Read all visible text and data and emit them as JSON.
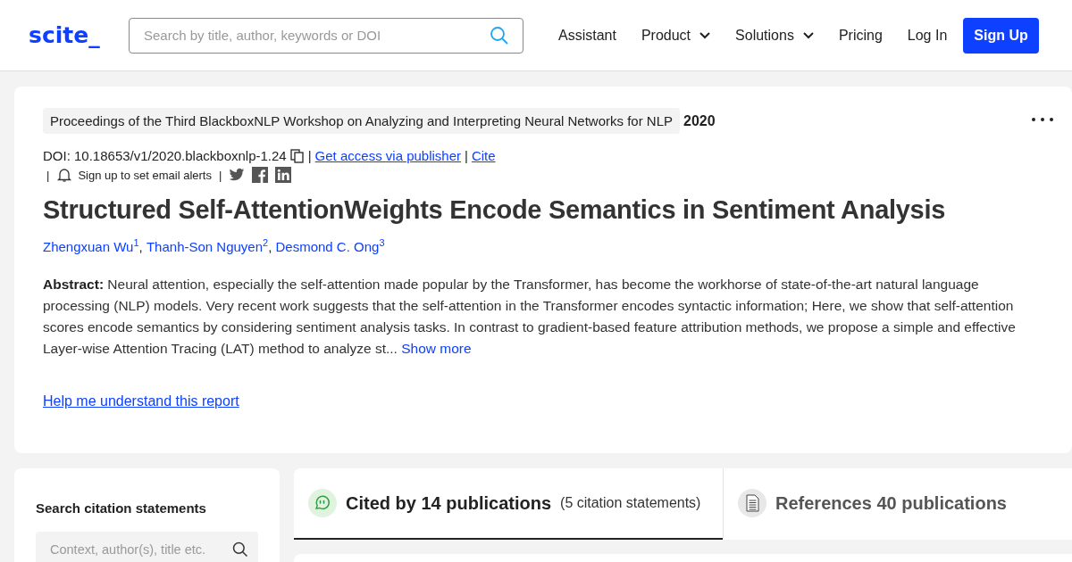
{
  "header": {
    "logo": "scite_",
    "search": {
      "placeholder": "Search by title, author, keywords or DOI"
    },
    "nav": [
      {
        "label": "Assistant",
        "kind": "link"
      },
      {
        "label": "Product",
        "kind": "dropdown"
      },
      {
        "label": "Solutions",
        "kind": "dropdown"
      },
      {
        "label": "Pricing",
        "kind": "link"
      },
      {
        "label": "Log In",
        "kind": "link"
      }
    ],
    "signup": "Sign Up"
  },
  "paper": {
    "venue": "Proceedings of the Third BlackboxNLP Workshop on Analyzing and Interpreting Neural Networks for NLP",
    "year": "2020",
    "meta_rows": [
      [
        {
          "kind": "text",
          "text": "DOI: 10.18653/v1/2020.blackboxnlp-1.24"
        },
        {
          "kind": "copy"
        },
        {
          "kind": "sep",
          "text": "|"
        },
        {
          "kind": "link",
          "text": "Get access via publisher"
        },
        {
          "kind": "sep",
          "text": "|"
        },
        {
          "kind": "link",
          "text": "Cite"
        }
      ],
      [
        {
          "kind": "sep",
          "text": "|"
        },
        {
          "kind": "alert",
          "text": "Sign up to set email alerts"
        },
        {
          "kind": "sep",
          "text": "|"
        },
        {
          "kind": "twitter"
        },
        {
          "kind": "facebook"
        },
        {
          "kind": "linkedin"
        }
      ]
    ],
    "title": "Structured Self-AttentionWeights Encode Semantics in Sentiment Analysis",
    "authors": [
      {
        "name": "Zhengxuan Wu",
        "sup": "1"
      },
      {
        "name": "Thanh-Son Nguyen",
        "sup": "2"
      },
      {
        "name": "Desmond C. Ong",
        "sup": "3"
      }
    ],
    "author_sep": ",",
    "abstract": "**Abstract:** Neural attention, especially the self-attention made popular by the Transformer, has become the workhorse of state-of-the-art natural language processing (NLP) models. Very recent work suggests that the self-attention in the Transformer encodes syntactic information; Here, we show that self-attention scores encode semantics by considering sentiment analysis tasks. In contrast to gradient-based feature attribution methods, we propose a simple and effective Layer-wise Attention Tracing (LAT) method to analyze st...",
    "show_more": "Show more",
    "help_link": "Help me understand this report"
  },
  "sidebar": {
    "heading": "Search citation statements",
    "search": {
      "placeholder": "Context, author(s), title etc."
    }
  },
  "tabs": [
    {
      "kind": "cited",
      "title": "Cited by 14 publications",
      "detail": "(5 citation statements)",
      "selected": true
    },
    {
      "kind": "references",
      "title": "References 40 publications",
      "selected": false
    }
  ]
}
